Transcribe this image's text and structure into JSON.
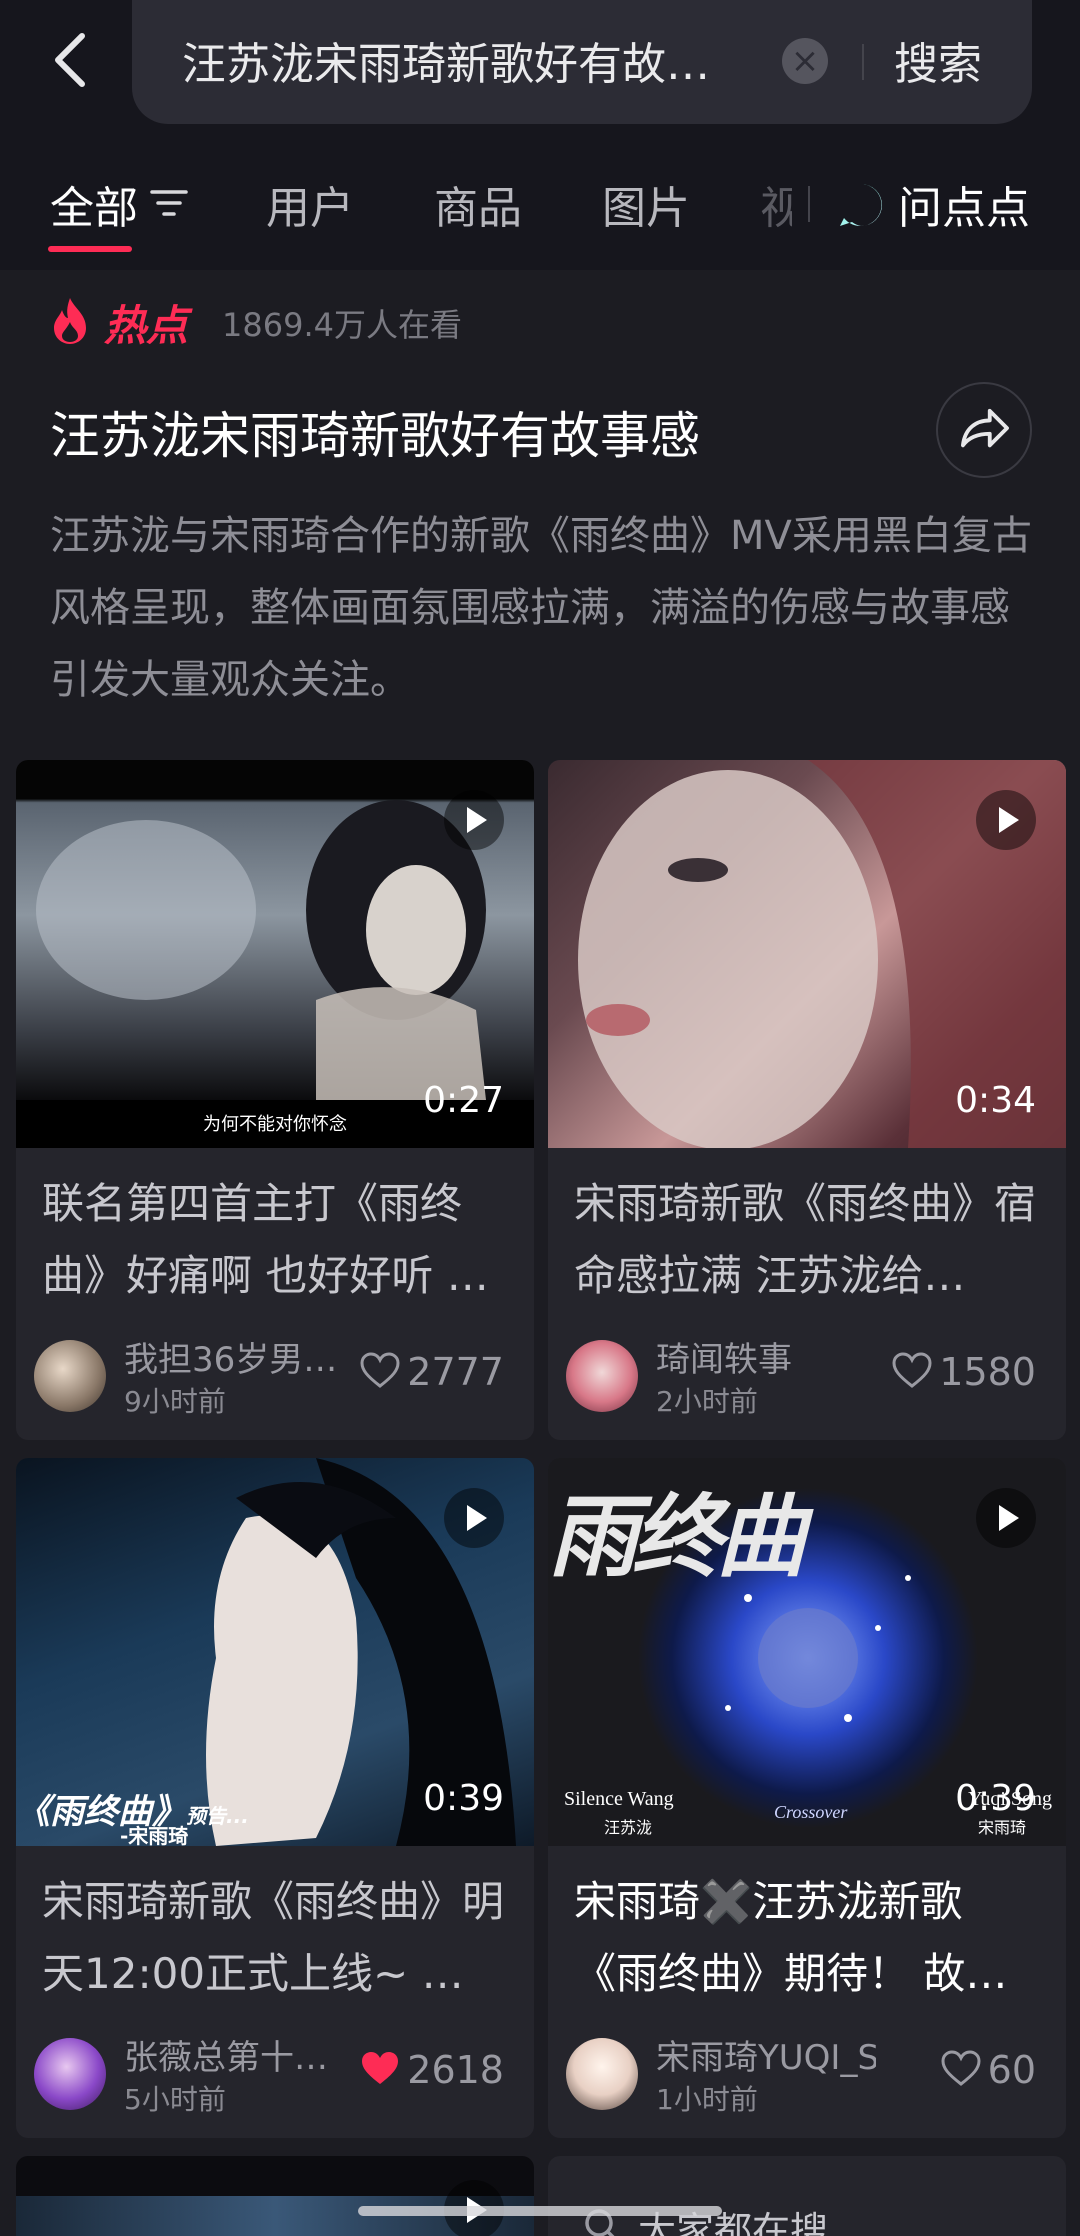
{
  "search": {
    "query": "汪苏泷宋雨琦新歌好有故…",
    "button": "搜索",
    "clear_icon": "clear-icon"
  },
  "tabs": [
    {
      "label": "全部",
      "active": true
    },
    {
      "label": "用户"
    },
    {
      "label": "商品"
    },
    {
      "label": "图片"
    }
  ],
  "tab_overflow_glyph": "视",
  "ask_label": "问点点",
  "hot": {
    "badge": "热点",
    "viewers": "1869.4万人在看",
    "title": "汪苏泷宋雨琦新歌好有故事感",
    "description": "汪苏泷与宋雨琦合作的新歌《雨终曲》MV采用黑白复古风格呈现，整体画面氛围感拉满，满溢的伤感与故事感引发大量观众关注。"
  },
  "cards": [
    {
      "duration": "0:27",
      "title": "联名第四首主打《雨终曲》好痛啊 也好好听 …",
      "author": "我担36岁男…",
      "time": "9小时前",
      "likes": "2777",
      "liked": false,
      "subtitle": "为何不能对你怀念"
    },
    {
      "duration": "0:34",
      "title": "宋雨琦新歌《雨终曲》宿命感拉满 汪苏泷给…",
      "author": "琦闻轶事",
      "time": "2小时前",
      "likes": "1580",
      "liked": false
    },
    {
      "duration": "0:39",
      "title": "宋雨琦新歌《雨终曲》明天12:00正式上线~ …",
      "author": "张薇总第十…",
      "time": "5小时前",
      "likes": "2618",
      "liked": true,
      "overlay_main": "《雨终曲》",
      "overlay_tag": "预告...",
      "overlay_sub": "-宋雨琦"
    },
    {
      "duration": "0:39",
      "title": "宋雨琦✖️汪苏泷新歌《雨终曲》期待！ 故…",
      "author": "宋雨琦YUQI_S…",
      "time": "1小时前",
      "likes": "60",
      "liked": false,
      "art_title": "雨终曲",
      "art_left": "Silence Wang",
      "art_left_cn": "汪苏泷",
      "art_center": "Crossover",
      "art_right": "Yuqi Song",
      "art_right_cn": "宋雨琦"
    }
  ],
  "bottom_hint": "大家都在搜",
  "colors": {
    "accent": "#fe2c55",
    "background": "#16161d",
    "card": "#25252c"
  }
}
